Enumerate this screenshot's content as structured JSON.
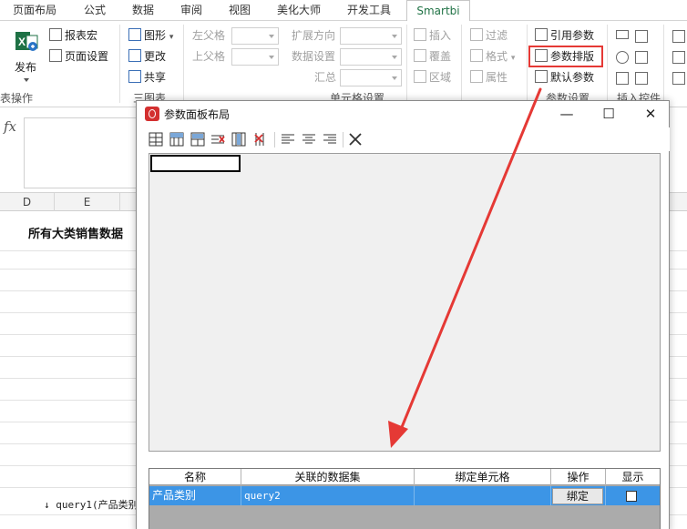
{
  "ribbon": {
    "tabs": [
      {
        "label": "页面布局",
        "active": false
      },
      {
        "label": "公式",
        "active": false
      },
      {
        "label": "数据",
        "active": false
      },
      {
        "label": "审阅",
        "active": false
      },
      {
        "label": "视图",
        "active": false
      },
      {
        "label": "美化大师",
        "active": false
      },
      {
        "label": "开发工具",
        "active": false
      },
      {
        "label": "Smartbi",
        "active": true
      }
    ],
    "publish_label": "发布",
    "report_macro": "报表宏",
    "page_setup": "页面设置",
    "chart": "图形",
    "change": "更改",
    "share": "共享",
    "left_parent": "左父格",
    "top_parent": "上父格",
    "expand_direction": "扩展方向",
    "data_settings": "数据设置",
    "summary": "汇总",
    "insert": "插入",
    "overwrite": "覆盖",
    "region": "区域",
    "filter": "过滤",
    "format": "格式",
    "attribute": "属性",
    "ref_param": "引用参数",
    "param_layout": "参数排版",
    "default_param": "默认参数",
    "group_report_ops": "表操作",
    "group_chart": "三图表",
    "group_cell": "单元格设置",
    "group_param": "参数设置",
    "group_insert": "插入控件",
    "highlight_color": "#e53935"
  },
  "sheet": {
    "columns": [
      "D",
      "E"
    ],
    "title": "所有大类销售数据",
    "cell_note": "↓ query1(产品类别"
  },
  "dialog": {
    "title": "参数面板布局",
    "minimize": "—",
    "maximize": "☐",
    "close": "✕",
    "toolbar_icons": [
      "insert-row-icon",
      "insert-column-icon",
      "split-cells-icon",
      "delete-row-icon",
      "merge-cells-icon",
      "delete-column-icon",
      "align-left-icon",
      "align-center-icon",
      "align-right-icon",
      "clear-icon"
    ],
    "table": {
      "headers": [
        "名称",
        "关联的数据集",
        "绑定单元格",
        "操作",
        "显示"
      ],
      "rows": [
        {
          "name": "产品类别",
          "dataset": "query2",
          "cell": "",
          "action": "绑定",
          "show": false
        }
      ]
    },
    "selection_color": "#3c95e6"
  },
  "annotation": {
    "arrow_color": "#e53935"
  }
}
